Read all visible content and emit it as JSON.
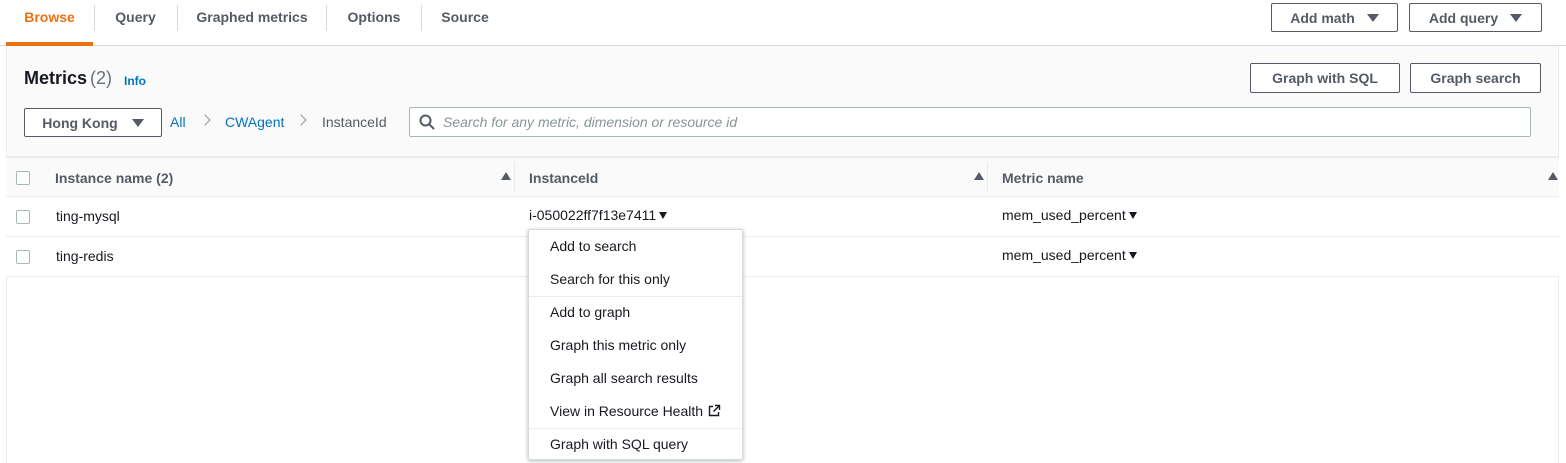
{
  "tabs": [
    {
      "label": "Browse",
      "active": true
    },
    {
      "label": "Query",
      "active": false
    },
    {
      "label": "Graphed metrics",
      "active": false
    },
    {
      "label": "Options",
      "active": false
    },
    {
      "label": "Source",
      "active": false
    }
  ],
  "top_actions": {
    "add_math": "Add math",
    "add_query": "Add query"
  },
  "metrics": {
    "title": "Metrics",
    "count": "(2)",
    "info": "Info",
    "graph_with_sql": "Graph with SQL",
    "graph_search": "Graph search"
  },
  "filter": {
    "region": "Hong Kong",
    "breadcrumb": [
      "All",
      "CWAgent",
      "InstanceId"
    ],
    "search_placeholder": "Search for any metric, dimension or resource id"
  },
  "table": {
    "columns": [
      "Instance name  (2)",
      "InstanceId",
      "Metric name"
    ],
    "rows": [
      {
        "instance_name": "ting-mysql",
        "instance_id": "i-050022ff7f13e7411",
        "metric_name": "mem_used_percent"
      },
      {
        "instance_name": "ting-redis",
        "instance_id": "",
        "metric_name": "mem_used_percent"
      }
    ]
  },
  "context_menu": {
    "items": [
      "Add to search",
      "Search for this only",
      "Add to graph",
      "Graph this metric only",
      "Graph all search results",
      "View in Resource Health",
      "Graph with SQL query"
    ]
  },
  "colors": {
    "accent": "#ec7211",
    "link": "#0073bb",
    "text": "#16191f",
    "muted": "#545b64"
  }
}
